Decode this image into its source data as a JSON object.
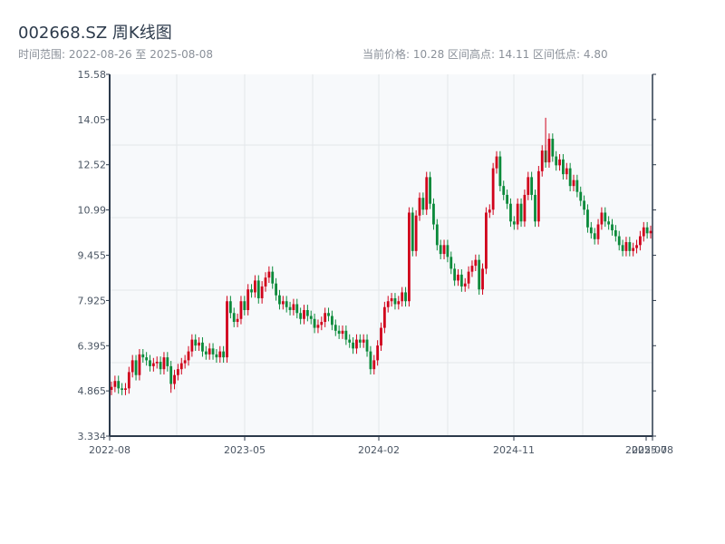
{
  "header": {
    "title": "002668.SZ 周K线图",
    "range_text": "时间范围: 2022-08-26 至 2025-08-08",
    "stats_text": "当前价格: 10.28  区间高点: 14.11  区间低点: 4.80"
  },
  "chart_data": {
    "type": "candlestick",
    "title": "002668.SZ 周K线图",
    "start_date": "2022-08-26",
    "end_date": "2025-08-08",
    "frequency": "weekly",
    "current_price": 10.28,
    "range_high": 14.11,
    "range_low": 4.8,
    "ylim": [
      3.334,
      15.58
    ],
    "y_ticks": [
      "15.58",
      "14.05",
      "12.52",
      "10.99",
      "9.455",
      "7.925",
      "6.395",
      "4.865",
      "3.334"
    ],
    "x_ticks": [
      "2022-08",
      "2023-05",
      "2024-02",
      "2024-11",
      "2025-07",
      "2025-08"
    ],
    "grid": true,
    "colors": {
      "up": "#d0021b",
      "down": "#0a8a3a",
      "plot_bg": "#f7f9fb",
      "grid": "#e3e6ea",
      "axis": "#2c3a4b"
    },
    "close": [
      5.0,
      5.2,
      4.95,
      4.9,
      4.95,
      5.5,
      5.9,
      5.4,
      6.1,
      6.0,
      5.9,
      5.7,
      5.8,
      5.85,
      5.6,
      6.0,
      5.7,
      5.1,
      5.4,
      5.6,
      5.8,
      5.9,
      6.2,
      6.6,
      6.4,
      6.5,
      6.2,
      6.1,
      6.3,
      6.1,
      6.0,
      6.2,
      6.0,
      7.9,
      7.5,
      7.2,
      7.3,
      7.9,
      7.6,
      8.3,
      8.2,
      8.6,
      8.0,
      8.4,
      8.7,
      8.9,
      8.5,
      8.1,
      7.8,
      7.9,
      7.7,
      7.6,
      7.8,
      7.5,
      7.3,
      7.6,
      7.4,
      7.3,
      7.0,
      7.1,
      7.2,
      7.5,
      7.4,
      7.1,
      6.9,
      6.8,
      6.9,
      6.6,
      6.5,
      6.3,
      6.6,
      6.5,
      6.6,
      6.2,
      5.6,
      5.9,
      6.4,
      7.0,
      7.7,
      7.9,
      8.0,
      7.8,
      7.9,
      8.2,
      7.9,
      10.9,
      9.6,
      10.8,
      11.4,
      11.0,
      12.1,
      11.2,
      10.5,
      9.8,
      9.5,
      9.8,
      9.4,
      9.0,
      8.6,
      8.8,
      8.4,
      8.5,
      8.9,
      9.1,
      9.3,
      8.3,
      9.0,
      10.9,
      11.0,
      12.4,
      12.8,
      11.8,
      11.5,
      11.2,
      10.6,
      10.5,
      11.2,
      10.6,
      11.5,
      12.1,
      11.5,
      10.6,
      12.3,
      13.0,
      12.6,
      13.4,
      12.8,
      12.5,
      12.7,
      12.2,
      12.4,
      11.8,
      12.0,
      11.6,
      11.3,
      11.0,
      10.4,
      10.2,
      10.0,
      10.5,
      10.9,
      10.6,
      10.5,
      10.3,
      10.1,
      9.8,
      9.6,
      9.9,
      9.6,
      9.7,
      9.8,
      10.1,
      10.4,
      10.2,
      10.28
    ]
  }
}
